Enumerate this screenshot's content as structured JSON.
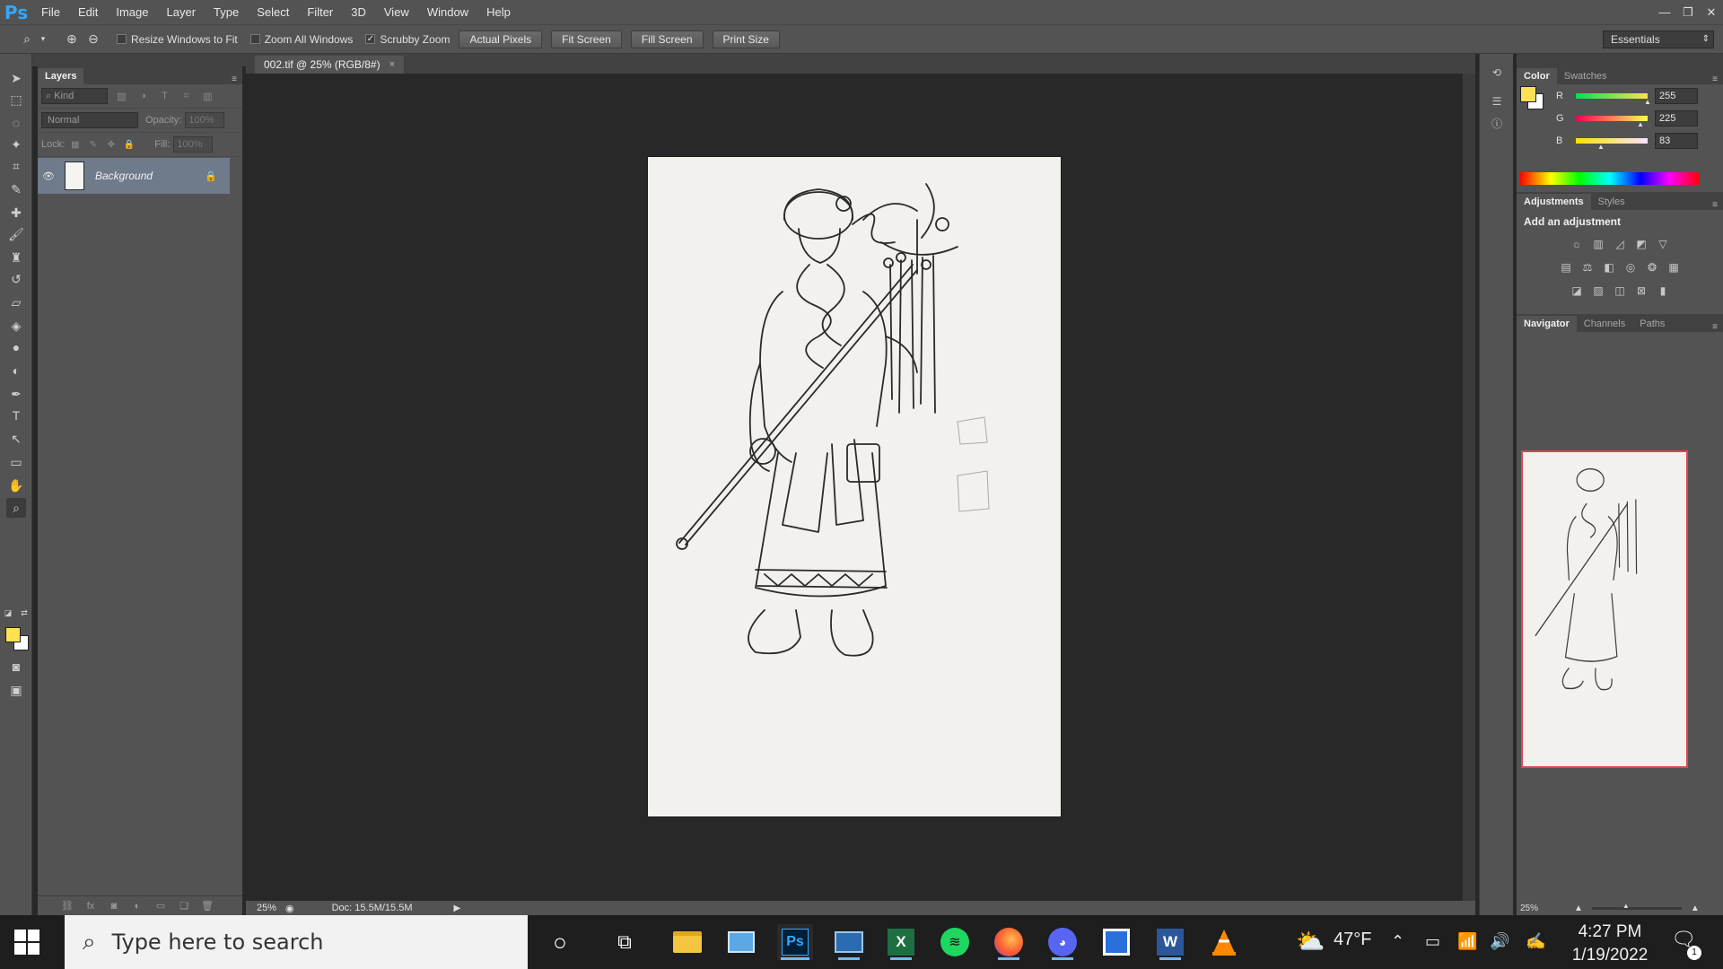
{
  "app": {
    "logo": "Ps"
  },
  "menu": [
    "File",
    "Edit",
    "Image",
    "Layer",
    "Type",
    "Select",
    "Filter",
    "3D",
    "View",
    "Window",
    "Help"
  ],
  "options_bar": {
    "checks": [
      {
        "label": "Resize Windows to Fit",
        "checked": false
      },
      {
        "label": "Zoom All Windows",
        "checked": false
      },
      {
        "label": "Scrubby Zoom",
        "checked": true
      }
    ],
    "buttons": [
      "Actual Pixels",
      "Fit Screen",
      "Fill Screen",
      "Print Size"
    ],
    "workspace": "Essentials"
  },
  "layers_panel": {
    "title": "Layers",
    "kind_filter": "Kind",
    "blend_mode": "Normal",
    "opacity_label": "Opacity:",
    "opacity_value": "100%",
    "lock_label": "Lock:",
    "fill_label": "Fill:",
    "fill_value": "100%",
    "layers": [
      {
        "name": "Background",
        "locked": true,
        "visible": true
      }
    ]
  },
  "document": {
    "tab": "002.tif @ 25% (RGB/8#)",
    "zoom": "25%",
    "doc_info": "Doc: 15.5M/15.5M"
  },
  "color_panel": {
    "tabs": [
      "Color",
      "Swatches"
    ],
    "foreground": "#ffe153",
    "background": "#ffffff",
    "channels": [
      {
        "label": "R",
        "value": "255"
      },
      {
        "label": "G",
        "value": "225"
      },
      {
        "label": "B",
        "value": "83"
      }
    ]
  },
  "adjustments_panel": {
    "tabs": [
      "Adjustments",
      "Styles"
    ],
    "title": "Add an adjustment"
  },
  "navigator_panel": {
    "tabs": [
      "Navigator",
      "Channels",
      "Paths"
    ],
    "zoom": "25%"
  },
  "taskbar": {
    "search_placeholder": "Type here to search",
    "temperature": "47°F",
    "time": "4:27 PM",
    "date": "1/19/2022",
    "notification_count": "1"
  }
}
